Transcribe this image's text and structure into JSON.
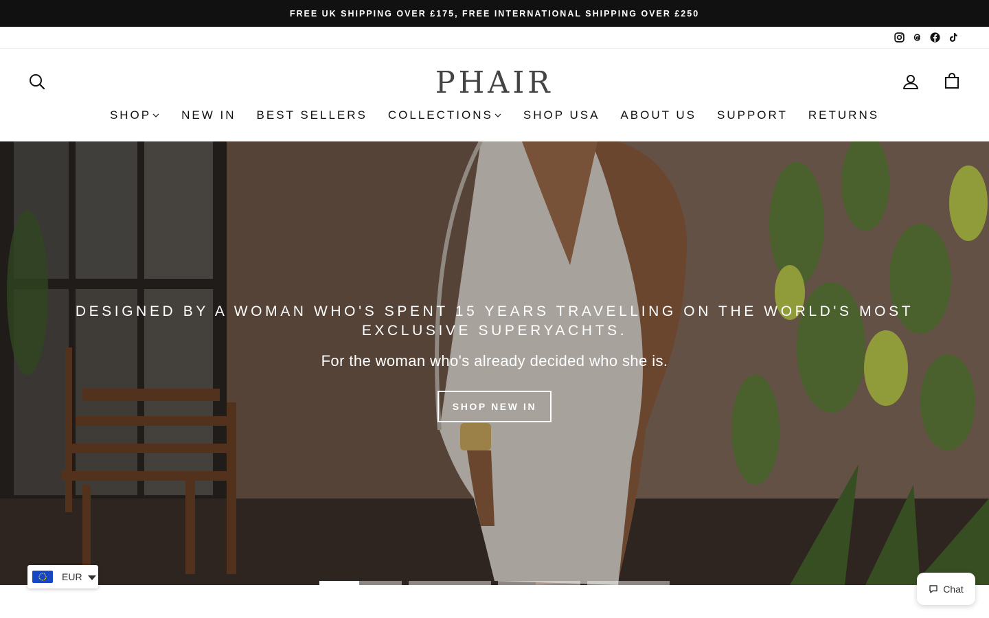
{
  "announcement": {
    "text": "FREE UK SHIPPING OVER £175, FREE INTERNATIONAL SHIPPING OVER £250"
  },
  "social": {
    "icons": [
      "instagram-icon",
      "threads-icon",
      "facebook-icon",
      "tiktok-icon"
    ]
  },
  "header": {
    "logo": "PHAIR",
    "icons": [
      "search-icon",
      "account-icon",
      "cart-icon"
    ]
  },
  "nav": {
    "items": [
      {
        "label": "SHOP",
        "dropdown": true
      },
      {
        "label": "NEW IN",
        "dropdown": false
      },
      {
        "label": "BEST SELLERS",
        "dropdown": false
      },
      {
        "label": "COLLECTIONS",
        "dropdown": true
      },
      {
        "label": "SHOP USA",
        "dropdown": false
      },
      {
        "label": "ABOUT US",
        "dropdown": false
      },
      {
        "label": "SUPPORT",
        "dropdown": false
      },
      {
        "label": "RETURNS",
        "dropdown": false
      }
    ]
  },
  "hero": {
    "heading": "DESIGNED BY A WOMAN WHO'S SPENT 15 YEARS TRAVELLING ON THE WORLD'S MOST EXCLUSIVE SUPERYACHTS.",
    "subheading": "For the woman who's already decided who she is.",
    "button": "SHOP NEW IN",
    "slides": {
      "count": 4,
      "active": 1,
      "progress": 0.48
    }
  },
  "currency": {
    "code": "EUR",
    "flag_icon": "eu-flag-icon"
  },
  "chat": {
    "label": "Chat"
  },
  "colors": {
    "announcement_bg": "#111111",
    "text": "#111111",
    "logo": "#444444",
    "white": "#ffffff"
  }
}
